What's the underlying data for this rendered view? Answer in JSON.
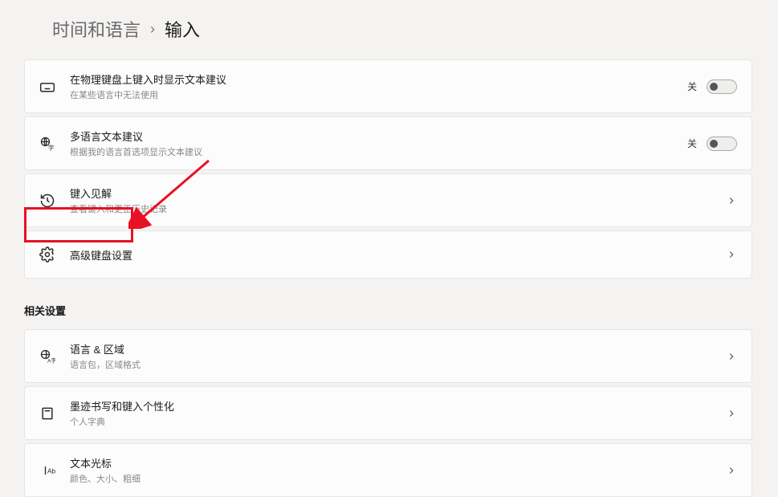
{
  "breadcrumb": {
    "parent": "时间和语言",
    "separator": "›",
    "current": "输入"
  },
  "cards": {
    "text_suggestions": {
      "title": "在物理键盘上键入时显示文本建议",
      "sub": "在某些语言中无法使用",
      "toggle_label": "关"
    },
    "multilingual": {
      "title": "多语言文本建议",
      "sub": "根据我的语言首选项显示文本建议",
      "toggle_label": "关"
    },
    "insights": {
      "title": "键入见解",
      "sub": "查看键入和更正历史记录"
    },
    "advanced": {
      "title": "高级键盘设置"
    }
  },
  "related": {
    "heading": "相关设置",
    "language_region": {
      "title": "语言 & 区域",
      "sub": "语言包，区域格式"
    },
    "inking": {
      "title": "墨迹书写和键入个性化",
      "sub": "个人字典"
    },
    "text_cursor": {
      "title": "文本光标",
      "sub": "颜色、大小、粗细"
    }
  }
}
